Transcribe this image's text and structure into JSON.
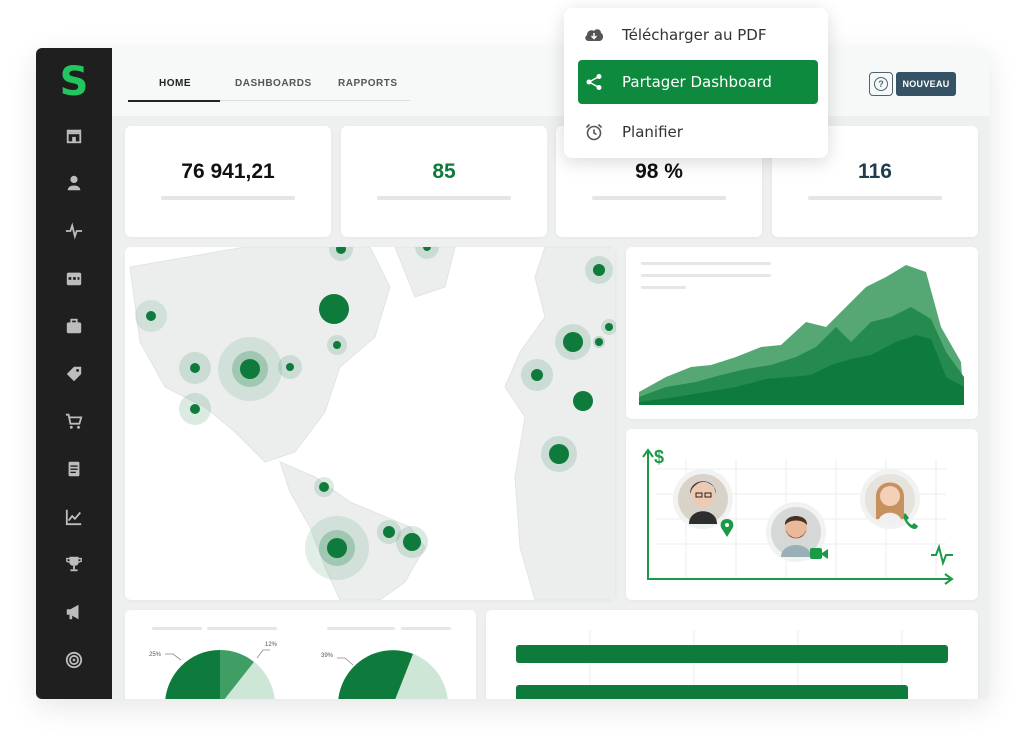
{
  "nav": {
    "tabs": [
      {
        "label": "HOME"
      },
      {
        "label": "DASHBOARDS"
      },
      {
        "label": "RAPPORTS"
      }
    ],
    "help_label": "?",
    "new_button_label": "NOUVEAU"
  },
  "sidebar": {
    "logo": "S",
    "icons": [
      "store-icon",
      "user-icon",
      "pulse-icon",
      "calendar-icon",
      "briefcase-icon",
      "tag-icon",
      "cart-icon",
      "document-icon",
      "line-chart-icon",
      "trophy-icon",
      "megaphone-icon",
      "target-icon"
    ]
  },
  "kpis": [
    {
      "value": "76 941,21",
      "color": "#111111"
    },
    {
      "value": "85",
      "color": "#0e7a3c"
    },
    {
      "value": "98 %",
      "color": "#111111"
    },
    {
      "value": "116",
      "color": "#1f3d4d"
    }
  ],
  "menu": {
    "items": [
      {
        "label": "Télécharger au PDF",
        "icon": "cloud-download-icon"
      },
      {
        "label": "Partager Dashboard",
        "icon": "share-icon"
      },
      {
        "label": "Planifier",
        "icon": "alarm-clock-icon"
      }
    ]
  },
  "pies": [
    {
      "labels": [
        "25%",
        "12%"
      ]
    },
    {
      "labels": [
        "39%"
      ]
    }
  ],
  "contacts": {
    "axis_symbol": "$",
    "people": [
      {
        "name": "woman-glasses",
        "badge": "location-pin-icon"
      },
      {
        "name": "man-beard",
        "badge": "video-camera-icon"
      },
      {
        "name": "woman-blonde",
        "badge": "phone-icon"
      }
    ]
  },
  "colors": {
    "accent": "#0e8a3e",
    "dark_green": "#0e7a3c",
    "sidebar": "#1f1f1f",
    "logo": "#22c55e",
    "button_dark": "#355364"
  }
}
